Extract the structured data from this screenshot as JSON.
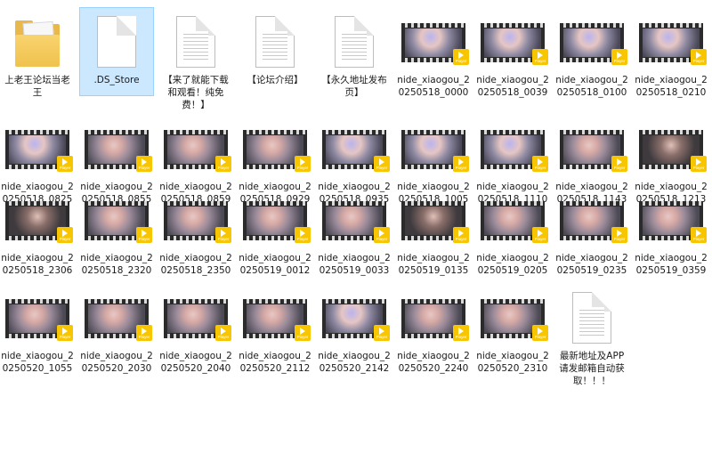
{
  "badge_text": "Player",
  "items": [
    {
      "type": "folder",
      "label": "上老王论坛当老王"
    },
    {
      "type": "file-blank",
      "label": ".DS_Store",
      "selected": true
    },
    {
      "type": "document",
      "label": "【来了就能下载和观看！纯免费！】"
    },
    {
      "type": "document",
      "label": "【论坛介绍】"
    },
    {
      "type": "document",
      "label": "【永久地址发布页】"
    },
    {
      "type": "video",
      "style": "purple",
      "label": "nide_xiaogou_20250518_0000"
    },
    {
      "type": "video",
      "style": "purple",
      "label": "nide_xiaogou_20250518_0039"
    },
    {
      "type": "video",
      "style": "purple",
      "label": "nide_xiaogou_20250518_0100"
    },
    {
      "type": "video",
      "style": "purple",
      "label": "nide_xiaogou_20250518_0210"
    },
    {
      "type": "video",
      "style": "purple",
      "label": "nide_xiaogou_20250518_0825"
    },
    {
      "type": "video",
      "style": "normal",
      "label": "nide_xiaogou_20250518_0855"
    },
    {
      "type": "video",
      "style": "normal",
      "label": "nide_xiaogou_20250518_0859"
    },
    {
      "type": "video",
      "style": "normal",
      "label": "nide_xiaogou_20250518_0929"
    },
    {
      "type": "video",
      "style": "purple",
      "label": "nide_xiaogou_20250518_0935"
    },
    {
      "type": "video",
      "style": "purple",
      "label": "nide_xiaogou_20250518_1005"
    },
    {
      "type": "video",
      "style": "purple",
      "label": "nide_xiaogou_20250518_1110"
    },
    {
      "type": "video",
      "style": "normal",
      "label": "nide_xiaogou_20250518_1143"
    },
    {
      "type": "video",
      "style": "dark",
      "label": "nide_xiaogou_20250518_1213"
    },
    {
      "type": "video",
      "style": "dark",
      "label": "nide_xiaogou_20250518_2306"
    },
    {
      "type": "video",
      "style": "normal",
      "label": "nide_xiaogou_20250518_2320"
    },
    {
      "type": "video",
      "style": "normal",
      "label": "nide_xiaogou_20250518_2350"
    },
    {
      "type": "video",
      "style": "normal",
      "label": "nide_xiaogou_20250519_0012"
    },
    {
      "type": "video",
      "style": "normal",
      "label": "nide_xiaogou_20250519_0033"
    },
    {
      "type": "video",
      "style": "dark",
      "label": "nide_xiaogou_20250519_0135"
    },
    {
      "type": "video",
      "style": "normal",
      "label": "nide_xiaogou_20250519_0205"
    },
    {
      "type": "video",
      "style": "normal",
      "label": "nide_xiaogou_20250519_0235"
    },
    {
      "type": "video",
      "style": "normal",
      "label": "nide_xiaogou_20250519_0359"
    },
    {
      "type": "video",
      "style": "normal",
      "label": "nide_xiaogou_20250520_1055"
    },
    {
      "type": "video",
      "style": "normal",
      "label": "nide_xiaogou_20250520_2030"
    },
    {
      "type": "video",
      "style": "normal",
      "label": "nide_xiaogou_20250520_2040"
    },
    {
      "type": "video",
      "style": "normal",
      "label": "nide_xiaogou_20250520_2112"
    },
    {
      "type": "video",
      "style": "purple",
      "label": "nide_xiaogou_20250520_2142"
    },
    {
      "type": "video",
      "style": "normal",
      "label": "nide_xiaogou_20250520_2240"
    },
    {
      "type": "video",
      "style": "normal",
      "label": "nide_xiaogou_20250520_2310"
    },
    {
      "type": "document",
      "label": "最新地址及APP请发邮箱自动获取！！！"
    }
  ]
}
